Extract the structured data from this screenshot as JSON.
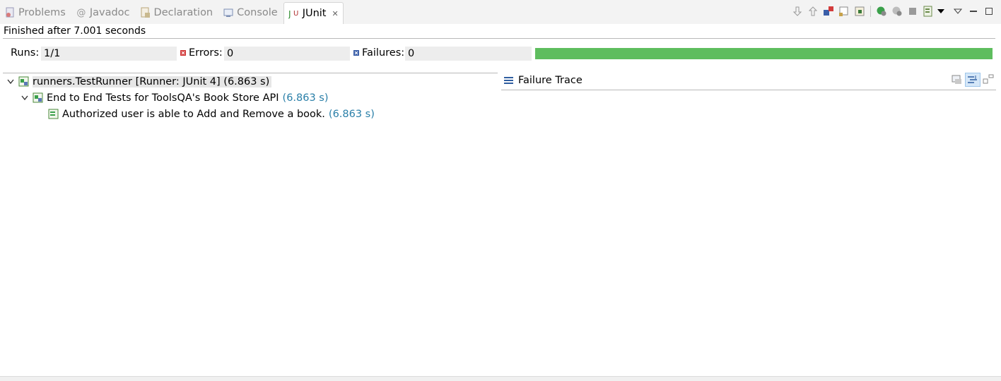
{
  "tabs": [
    {
      "label": "Problems",
      "icon": "problems-icon",
      "active": false
    },
    {
      "label": "Javadoc",
      "icon": "javadoc-icon",
      "active": false
    },
    {
      "label": "Declaration",
      "icon": "declaration-icon",
      "active": false
    },
    {
      "label": "Console",
      "icon": "console-icon",
      "active": false
    },
    {
      "label": "JUnit",
      "icon": "junit-icon",
      "active": true
    }
  ],
  "toolbar": {
    "icons": [
      "next-failure-icon",
      "previous-failure-icon",
      "failures-only-icon",
      "scroll-lock-icon",
      "show-skipped-icon",
      "rerun-icon",
      "rerun-failed-first-icon",
      "stop-icon",
      "history-icon",
      "view-menu-icon",
      "minimize-icon",
      "maximize-icon"
    ]
  },
  "status": "Finished after 7.001 seconds",
  "counters": {
    "runs_label": "Runs:",
    "runs_value": "1/1",
    "errors_label": "Errors:",
    "errors_value": "0",
    "failures_label": "Failures:",
    "failures_value": "0"
  },
  "progress": {
    "fraction": 1.0,
    "color": "#5ebd5e"
  },
  "tree": [
    {
      "label": "runners.TestRunner [Runner: JUnit 4] (6.863 s)",
      "time": "",
      "expanded": true,
      "level": 0,
      "selected": true
    },
    {
      "label": "End to End Tests for ToolsQA's Book Store API",
      "time": "(6.863 s)",
      "expanded": true,
      "level": 1,
      "selected": false
    },
    {
      "label": "Authorized user is able to Add and Remove a book.",
      "time": "(6.863 s)",
      "expanded": false,
      "level": 2,
      "selected": false
    }
  ],
  "failure_trace": {
    "title": "Failure Trace",
    "tools": [
      "filter-stack-icon",
      "compare-results-icon",
      "copy-trace-icon"
    ]
  },
  "colors": {
    "time": "#2a7fa8",
    "success": "#5ebd5e"
  }
}
